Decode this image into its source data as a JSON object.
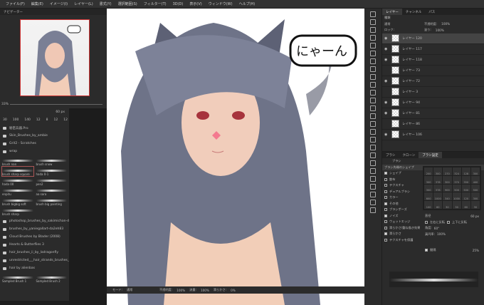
{
  "menu": [
    "ファイル(F)",
    "編集(E)",
    "イメージ(I)",
    "レイヤー(L)",
    "書式(Y)",
    "選択範囲(S)",
    "フィルター(T)",
    "3D(D)",
    "表示(V)",
    "ウィンドウ(W)",
    "ヘルプ(H)"
  ],
  "navigator": {
    "title": "ナビゲーター",
    "zoom": "33%"
  },
  "brush_panel": {
    "size": "60 px",
    "presets": [
      "30",
      "100",
      "140",
      "12",
      "8",
      "12",
      "12"
    ],
    "folders_top": [
      "秘密兵器.Pro",
      "Skin_Brushes_by_ambie",
      "Grit2 - Scratches",
      "wrap"
    ],
    "brushes": [
      "brush nan",
      "brush snow",
      "brush sharp square",
      "hada 0-1",
      "hada 00",
      "pen2",
      "enpitu",
      "aa sara",
      "brush bigbig soft",
      "brush big painting",
      "brush sharp"
    ],
    "folders_bottom": [
      "photoshop_brushes_by_sakimichan-d5kb5b",
      "brushes_by_yaniegallart-da2eh83",
      "Cloud Brushes by Blader (2008)",
      "Hearts & Butterflies 3",
      "hair_brushes_ii_by_ladragonfly",
      "unrestricted___hair_strands_brushes_by_froze...",
      "hair by alienbas"
    ],
    "sampled": [
      "Sampled Brush 1",
      "Sampled Brush 2"
    ]
  },
  "canvas": {
    "speech": "にゃーん"
  },
  "layers": {
    "tabs": [
      "レイヤー",
      "チャンネル",
      "パス"
    ],
    "filter": "種類",
    "blend": "通常",
    "opacity_label": "不透明度:",
    "opacity": "100%",
    "lock_label": "ロック:",
    "fill_label": "塗り:",
    "fill": "100%",
    "items": [
      {
        "name": "レイヤー 120",
        "visible": true
      },
      {
        "name": "レイヤー 117",
        "visible": true
      },
      {
        "name": "レイヤー 118",
        "visible": true
      },
      {
        "name": "レイヤー 73",
        "visible": false
      },
      {
        "name": "レイヤー 72",
        "visible": true
      },
      {
        "name": "レイヤー 3",
        "visible": false
      },
      {
        "name": "レイヤー 94",
        "visible": true
      },
      {
        "name": "レイヤー 81",
        "visible": true
      },
      {
        "name": "レイヤー 86",
        "visible": false
      },
      {
        "name": "レイヤー 106",
        "visible": true
      }
    ]
  },
  "brush_settings": {
    "tabs": [
      "ブラシ",
      "クローン",
      "ブラシ設定"
    ],
    "brush_button": "ブラシ",
    "tip_shape": "ブラシ先端のシェイプ",
    "options": [
      {
        "label": "シェイプ",
        "on": true
      },
      {
        "label": "散布",
        "on": false
      },
      {
        "label": "テクスチャ",
        "on": false
      },
      {
        "label": "デュアルブラシ",
        "on": false
      },
      {
        "label": "カラー",
        "on": false
      },
      {
        "label": "その他",
        "on": true
      },
      {
        "label": "ブラシポーズ",
        "on": false
      },
      {
        "label": "ノイズ",
        "on": true
      },
      {
        "label": "ウェットエッジ",
        "on": false
      },
      {
        "label": "滑らかさ/重ね描き効果",
        "on": false
      },
      {
        "label": "滑らかさ",
        "on": true
      },
      {
        "label": "テクスチャを保護",
        "on": false
      }
    ],
    "tips": [
      "200",
      "300",
      "270",
      "324",
      "128",
      "300",
      "300",
      "378",
      "300",
      "370",
      "350",
      "400",
      "300",
      "378",
      "900",
      "500",
      "500",
      "500",
      "600",
      "1000",
      "340",
      "1000",
      "120",
      "300",
      "100",
      "60",
      "30",
      "30",
      "60",
      "30"
    ],
    "size_label": "直径",
    "size": "60 px",
    "flip_x": "左右に反転",
    "flip_y": "上下に反転",
    "angle_label": "角度:",
    "angle": "60°",
    "roundness_label": "真円率:",
    "roundness": "100%",
    "spacing_label": "間隔",
    "spacing": "25%"
  },
  "options_bar": {
    "mode_label": "モード:",
    "mode": "通常",
    "opacity_label": "不透明度:",
    "opacity": "100%",
    "flow_label": "流量:",
    "flow": "100%",
    "smooth_label": "滑らかさ:",
    "smooth": "0%"
  }
}
